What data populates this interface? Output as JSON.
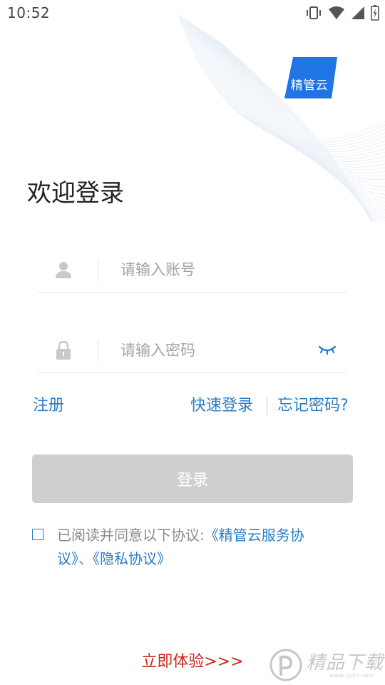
{
  "status_bar": {
    "time": "10:52",
    "icons": [
      "vibrate-icon",
      "wifi-icon",
      "signal-icon",
      "battery-icon"
    ]
  },
  "logo": {
    "text": "精管云",
    "color": "#1f74e6"
  },
  "page": {
    "title": "欢迎登录"
  },
  "form": {
    "account_placeholder": "请输入账号",
    "password_placeholder": "请输入密码"
  },
  "links": {
    "register": "注册",
    "quick_login": "快速登录",
    "forgot_password": "忘记密码?"
  },
  "login_button": {
    "label": "登录"
  },
  "agreement": {
    "prefix": "已阅读并同意以下协议:",
    "service": "《精管云服务协议》",
    "separator": "、",
    "privacy": "《隐私协议》"
  },
  "try_now": "立即体验>>>",
  "watermark": {
    "text": "精品下载",
    "sub": "www.jpxz.com"
  },
  "colors": {
    "accent": "#2a7cc7",
    "button_disabled": "#cfcfcf",
    "try_now": "#d0241c"
  }
}
